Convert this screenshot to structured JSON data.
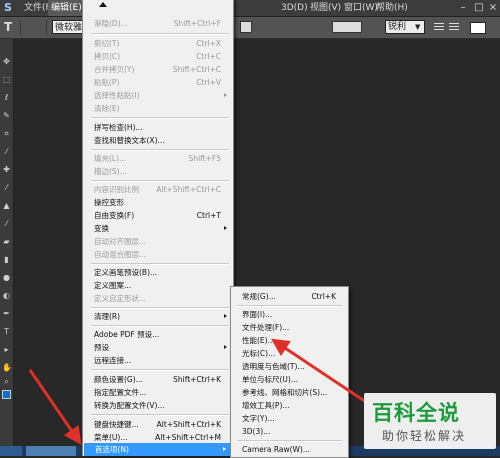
{
  "menubar": {
    "app_icon": "photoshop-logo",
    "items": [
      {
        "label": "文件(F)"
      },
      {
        "label": "编辑(E)"
      },
      {
        "label": "3D(D)"
      },
      {
        "label": "视图(V)"
      },
      {
        "label": "窗口(W)"
      },
      {
        "label": "帮助(H)"
      }
    ]
  },
  "options_bar": {
    "font_family": "微软雅",
    "antialias": "锐利",
    "text_color": "#ffffff"
  },
  "edit_menu": {
    "items": [
      {
        "label": "渐隐(D)...",
        "shortcut": "Shift+Ctrl+F",
        "disabled": true
      },
      {
        "label": "剪切(T)",
        "shortcut": "Ctrl+X",
        "disabled": true
      },
      {
        "label": "拷贝(C)",
        "shortcut": "Ctrl+C",
        "disabled": true
      },
      {
        "label": "合并拷贝(Y)",
        "shortcut": "Shift+Ctrl+C",
        "disabled": true
      },
      {
        "label": "粘贴(P)",
        "shortcut": "Ctrl+V",
        "disabled": true
      },
      {
        "label": "选择性粘贴(I)",
        "shortcut": "",
        "disabled": true
      },
      {
        "label": "清除(E)",
        "shortcut": "",
        "disabled": true
      },
      {
        "label": "拼写检查(H)...",
        "shortcut": "",
        "disabled": false
      },
      {
        "label": "查找和替换文本(X)...",
        "shortcut": "",
        "disabled": false
      },
      {
        "label": "填充(L)...",
        "shortcut": "Shift+F5",
        "disabled": true
      },
      {
        "label": "描边(S)...",
        "shortcut": "",
        "disabled": true
      },
      {
        "label": "内容识别比例",
        "shortcut": "Alt+Shift+Ctrl+C",
        "disabled": true
      },
      {
        "label": "操控变形",
        "shortcut": "",
        "disabled": false
      },
      {
        "label": "自由变换(F)",
        "shortcut": "Ctrl+T",
        "disabled": false
      },
      {
        "label": "变换",
        "shortcut": "",
        "disabled": false
      },
      {
        "label": "自动对齐图层...",
        "shortcut": "",
        "disabled": true
      },
      {
        "label": "自动混合图层...",
        "shortcut": "",
        "disabled": true
      },
      {
        "label": "定义画笔预设(B)...",
        "shortcut": "",
        "disabled": false
      },
      {
        "label": "定义图案...",
        "shortcut": "",
        "disabled": false
      },
      {
        "label": "定义自定形状...",
        "shortcut": "",
        "disabled": true
      },
      {
        "label": "清理(R)",
        "shortcut": "",
        "disabled": false
      },
      {
        "label": "Adobe PDF 预设...",
        "shortcut": "",
        "disabled": false
      },
      {
        "label": "预设",
        "shortcut": "",
        "disabled": false
      },
      {
        "label": "远程连接...",
        "shortcut": "",
        "disabled": false
      },
      {
        "label": "颜色设置(G)...",
        "shortcut": "Shift+Ctrl+K",
        "disabled": false
      },
      {
        "label": "指定配置文件...",
        "shortcut": "",
        "disabled": false
      },
      {
        "label": "转换为配置文件(V)...",
        "shortcut": "",
        "disabled": false
      },
      {
        "label": "键盘快捷键...",
        "shortcut": "Alt+Shift+Ctrl+K",
        "disabled": false
      },
      {
        "label": "菜单(U)...",
        "shortcut": "Alt+Shift+Ctrl+M",
        "disabled": false
      },
      {
        "label": "首选项(N)",
        "shortcut": "",
        "disabled": false
      }
    ]
  },
  "preferences_submenu": {
    "items": [
      {
        "label": "常规(G)...",
        "shortcut": "Ctrl+K"
      },
      {
        "label": "界面(I)..."
      },
      {
        "label": "文件处理(F)..."
      },
      {
        "label": "性能(E)..."
      },
      {
        "label": "光标(C)..."
      },
      {
        "label": "透明度与色域(T)..."
      },
      {
        "label": "单位与标尺(U)..."
      },
      {
        "label": "参考线、网格和切片(S)..."
      },
      {
        "label": "增效工具(P)..."
      },
      {
        "label": "文字(Y)..."
      },
      {
        "label": "3D(3)..."
      },
      {
        "label": "Camera Raw(W)..."
      }
    ]
  },
  "watermark": {
    "title": "百科全说",
    "subtitle": "助你轻松解决"
  },
  "colors": {
    "highlight": "#3399ff",
    "arrow": "#e0302a",
    "watermark_green": "#1e9a3e",
    "foreground_swatch": "#0c73c8"
  }
}
